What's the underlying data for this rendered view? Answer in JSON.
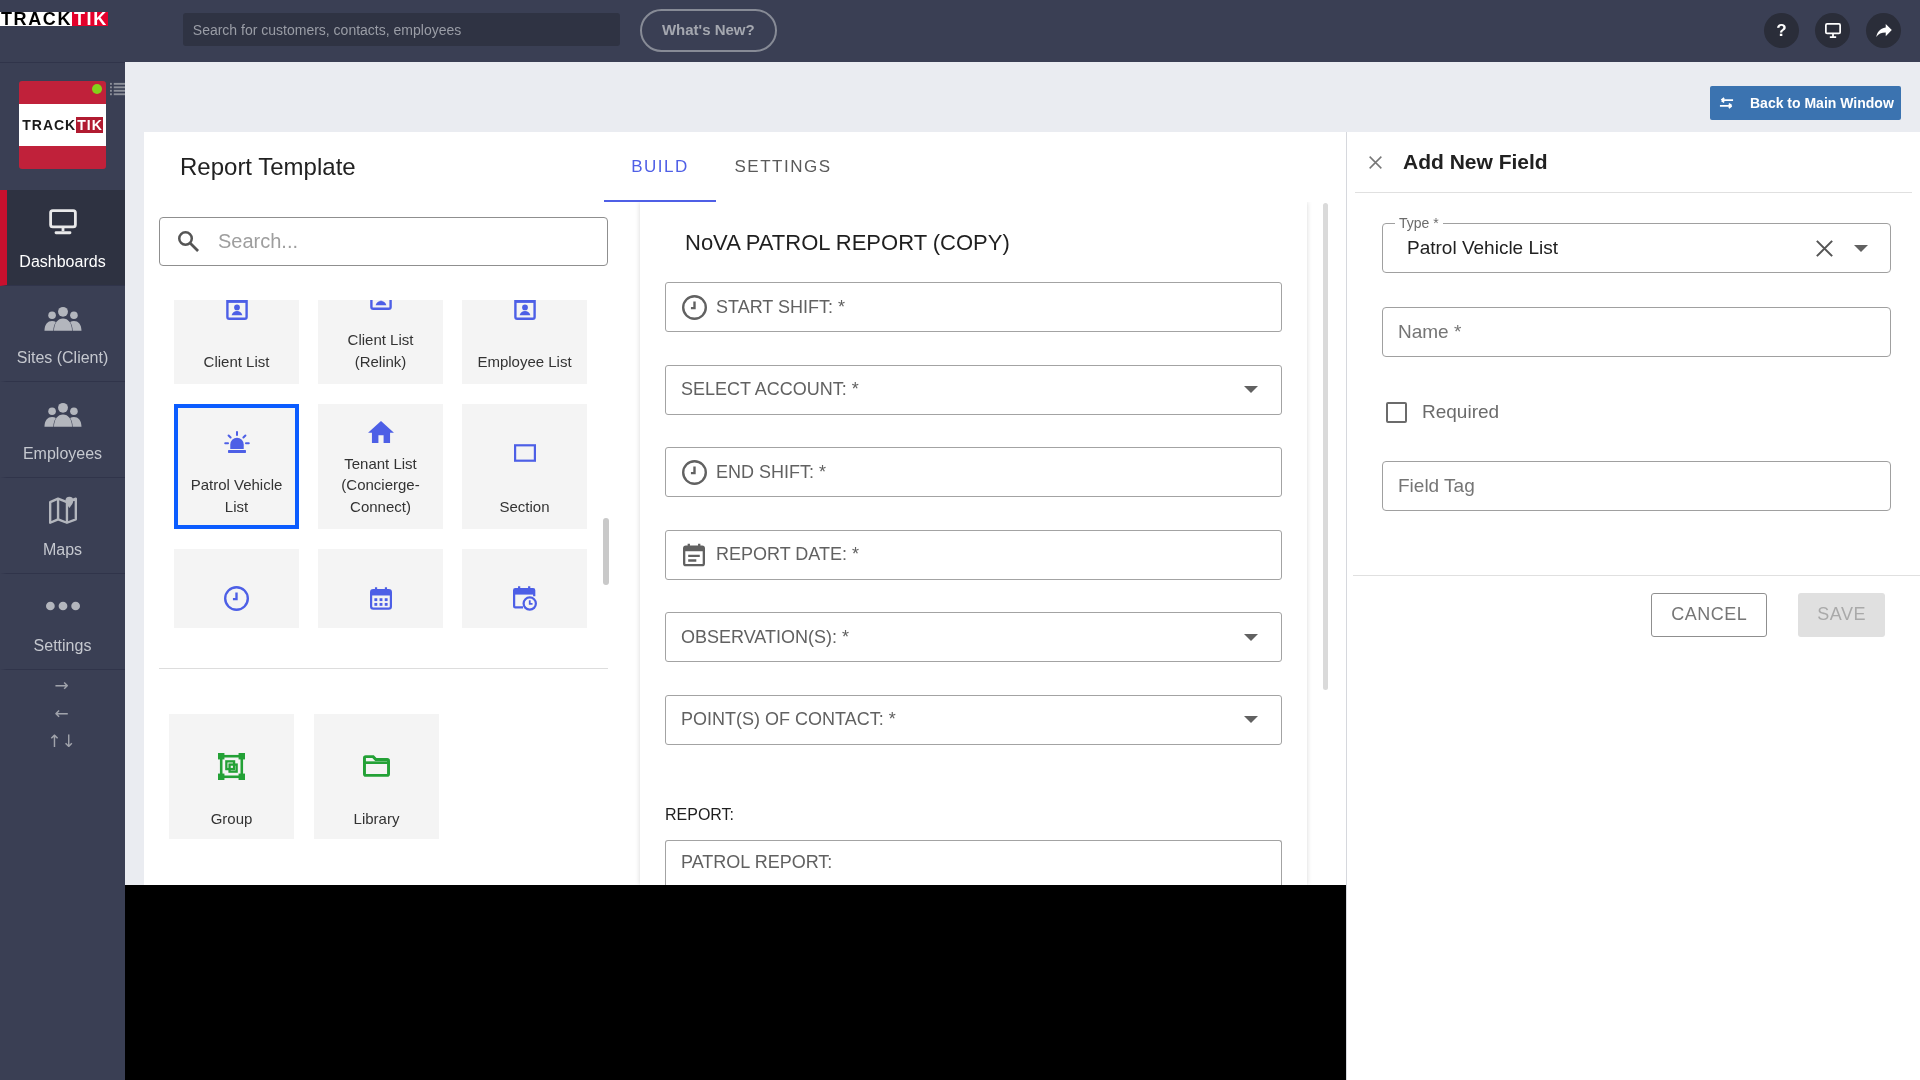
{
  "topbar": {
    "logo": [
      "TRACK",
      "TIK"
    ],
    "search": {
      "placeholder": "Search for customers, contacts, employees"
    },
    "whats_new": "What's New?",
    "help": "?"
  },
  "sidebar": {
    "logo": [
      "TRACK",
      "TIK"
    ],
    "online": true,
    "items": [
      {
        "label": "Dashboards",
        "selected": true
      },
      {
        "label": "Sites (Client)",
        "selected": false
      },
      {
        "label": "Employees",
        "selected": false
      },
      {
        "label": "Maps",
        "selected": false
      },
      {
        "label": "Settings",
        "selected": false
      }
    ],
    "arrows": [
      "→",
      "←",
      "↑↓"
    ]
  },
  "back_button": "Back to Main Window",
  "template": {
    "title": "Report Template",
    "tabs": [
      {
        "label": "BUILD",
        "selected": true
      },
      {
        "label": "SETTINGS",
        "selected": false
      }
    ]
  },
  "palette": {
    "search": {
      "placeholder": "Search..."
    },
    "tiles": [
      {
        "label": "Client List",
        "selected": false
      },
      {
        "label": "Client List (Relink)",
        "selected": false
      },
      {
        "label": "Employee List",
        "selected": false
      },
      {
        "label": "Patrol Vehicle List",
        "selected": true
      },
      {
        "label": "Tenant List (Concierge-Connect)",
        "selected": false
      },
      {
        "label": "Section",
        "selected": false
      },
      {
        "selected": false
      },
      {
        "selected": false
      },
      {
        "selected": false
      }
    ],
    "extra_tiles": [
      {
        "label": "Group"
      },
      {
        "label": "Library"
      }
    ]
  },
  "form": {
    "title": "NoVA PATROL REPORT (COPY)",
    "fields": [
      {
        "kind": "time",
        "label": "START SHIFT: *"
      },
      {
        "kind": "select",
        "label": "SELECT ACCOUNT: *"
      },
      {
        "kind": "time",
        "label": "END SHIFT: *"
      },
      {
        "kind": "date",
        "label": "REPORT DATE: *"
      },
      {
        "kind": "select",
        "label": "OBSERVATION(S): *"
      },
      {
        "kind": "select",
        "label": "POINT(S) OF CONTACT: *"
      }
    ],
    "section": {
      "label": "REPORT:",
      "fields": [
        {
          "kind": "text",
          "label": "PATROL REPORT:"
        }
      ]
    }
  },
  "panel": {
    "title": "Add New Field",
    "type_field": {
      "label": "Type *",
      "value": "Patrol Vehicle List"
    },
    "name_field": {
      "placeholder": "Name *"
    },
    "required": {
      "label": "Required",
      "checked": false
    },
    "tag_field": {
      "placeholder": "Field Tag"
    },
    "buttons": [
      {
        "label": "CANCEL",
        "disabled": false
      },
      {
        "label": "SAVE",
        "disabled": true
      }
    ]
  }
}
